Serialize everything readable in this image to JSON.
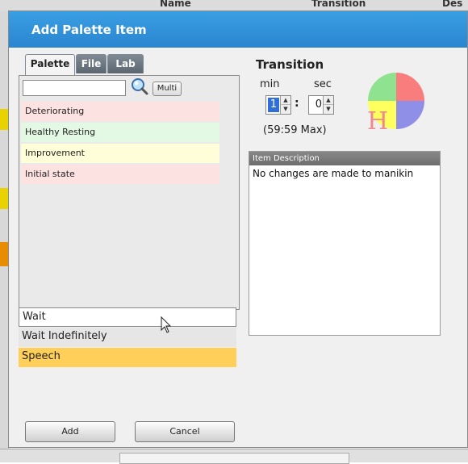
{
  "background": {
    "col_name": "Name",
    "col_transition": "Transition",
    "col_description_partial": "Des"
  },
  "dialog": {
    "title": "Add Palette Item",
    "tabs": [
      "Palette",
      "File",
      "Lab"
    ],
    "search": {
      "value": "",
      "placeholder": ""
    },
    "multi_label": "Multi",
    "palette_items": [
      "Deteriorating",
      "Healthy Resting",
      "Improvement",
      "Initial state"
    ],
    "type_items": [
      "Wait",
      "Wait Indefinitely",
      "Speech"
    ],
    "selected_type": "Wait",
    "add_label": "Add",
    "cancel_label": "Cancel"
  },
  "transition": {
    "title": "Transition",
    "min_label": "min",
    "sec_label": "sec",
    "min_value": "1",
    "sec_value": "0",
    "colon": ":",
    "max_note": "(59:59 Max)"
  },
  "description": {
    "header": "Item Description",
    "text": "No changes are made to manikin"
  },
  "colors": {
    "title_bar": "#2a85cf",
    "speech_highlight": "#ffcf5a",
    "deteriorating": "#fde2e2",
    "healthy": "#e3f9e3",
    "improvement": "#fefed8",
    "initial": "#fde2e2"
  },
  "icons": {
    "search": "magnifier-icon",
    "state": "quadrant-h-icon",
    "pointer": "mouse-cursor-icon"
  }
}
